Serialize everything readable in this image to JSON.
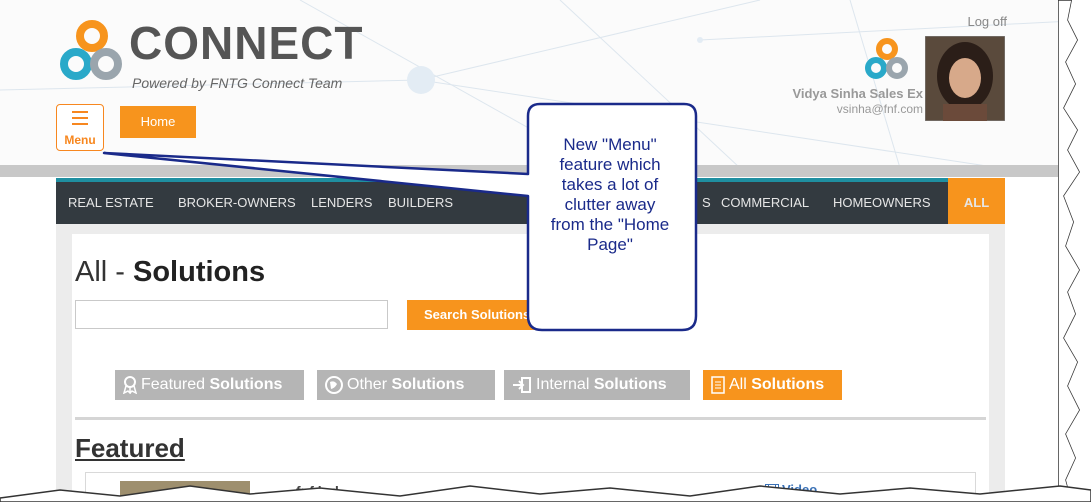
{
  "header": {
    "logo": {
      "title": "CONNECT",
      "tagline": "Powered by FNTG Connect Team"
    },
    "menu_button": {
      "label": "Menu"
    },
    "home_button": {
      "label": "Home"
    },
    "user": {
      "logoff": "Log off",
      "name": "Vidya Sinha Sales Ex",
      "email": "vsinha@fnf.com"
    }
  },
  "nav": {
    "items": [
      "REAL ESTATE",
      "BROKER-OWNERS",
      "LENDERS",
      "BUILDERS",
      "S",
      "COMMERCIAL",
      "HOMEOWNERS",
      "ALL"
    ],
    "active": "ALL"
  },
  "page": {
    "title_prefix": "All - ",
    "title_bold": "Solutions",
    "search": {
      "button": "Search Solutions",
      "value": ""
    },
    "tabs": [
      {
        "pre": "Featured ",
        "bold": "Solutions",
        "icon": "ribbon-icon",
        "active": false
      },
      {
        "pre": "Other ",
        "bold": "Solutions",
        "icon": "globe-icon",
        "active": false
      },
      {
        "pre": "Internal ",
        "bold": "Solutions",
        "icon": "sign-in-icon",
        "active": false
      },
      {
        "pre": "All ",
        "bold": "Solutions",
        "icon": "list-icon",
        "active": true
      }
    ],
    "section_title": "Featured",
    "card": {
      "title": "fnf ind",
      "link": "Video"
    }
  },
  "callout": {
    "lines": [
      "New \"Menu\"",
      "feature which",
      "takes a lot of",
      "clutter away",
      "from the \"Home",
      "Page\""
    ]
  },
  "colors": {
    "accent": "#f7941d",
    "nav_bg": "#333a40",
    "nav_top": "#1f8fa1",
    "callout_border": "#1a2a8a"
  }
}
